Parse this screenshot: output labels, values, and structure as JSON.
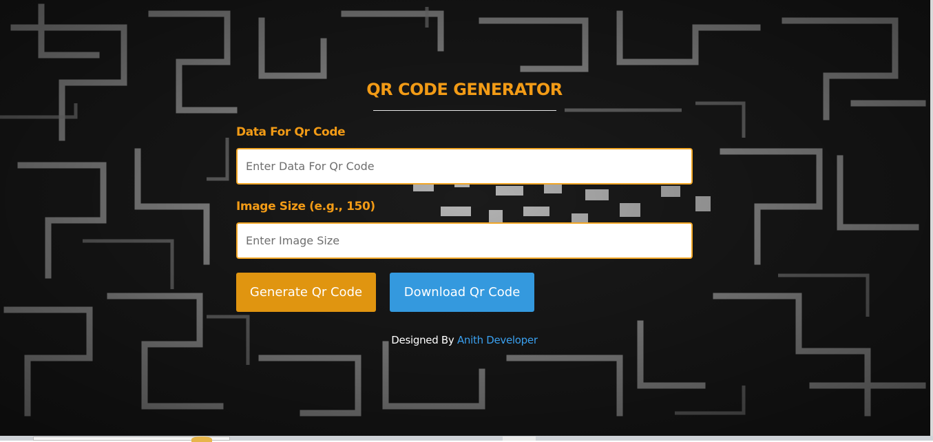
{
  "app": {
    "title": "QR CODE GENERATOR"
  },
  "form": {
    "data_label": "Data For Qr Code",
    "data_placeholder": "Enter Data For Qr Code",
    "data_value": "",
    "size_label": "Image Size (e.g., 150)",
    "size_placeholder": "Enter Image Size",
    "size_value": ""
  },
  "actions": {
    "generate_label": "Generate Qr Code",
    "download_label": "Download Qr Code"
  },
  "footer": {
    "prefix": "Designed By",
    "author": "Anith Developer"
  },
  "colors": {
    "accent": "#f29b16",
    "generate_button": "#e09510",
    "download_button": "#3499de",
    "link": "#3aa0ef"
  },
  "icons": {
    "background": "qr-maze-background"
  }
}
